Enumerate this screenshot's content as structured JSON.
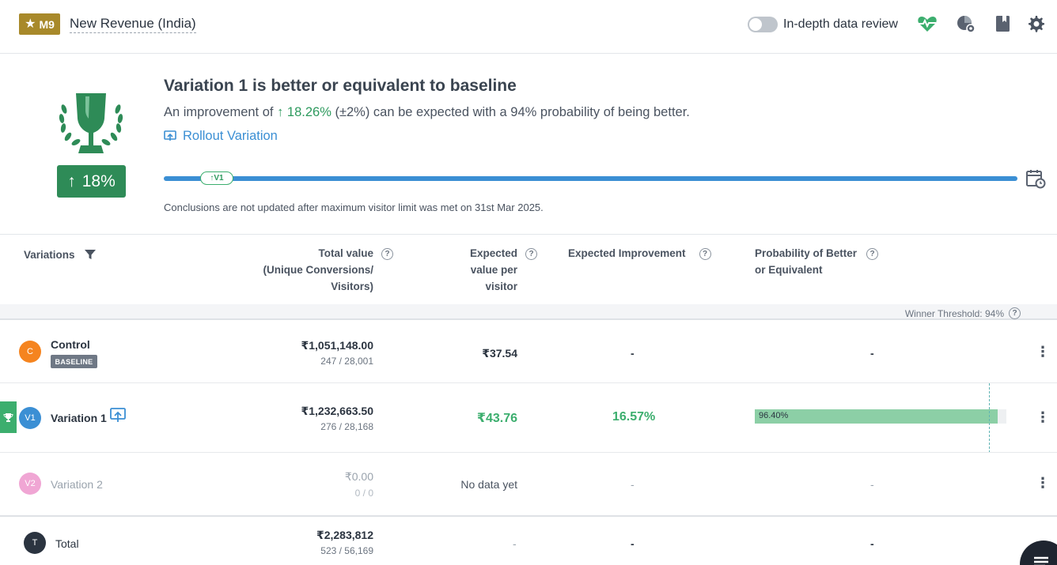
{
  "header": {
    "badge": "M9",
    "title": "New Revenue (India)",
    "toggle_label": "In-depth data review",
    "icons": [
      "star-icon",
      "heart-pulse-icon",
      "pie-chart-settings-icon",
      "book-icon",
      "gear-icon"
    ]
  },
  "summary": {
    "headline": "Variation 1 is better or equivalent to baseline",
    "sub_prefix": "An improvement of ",
    "sub_arrow": "↑",
    "sub_value": "18.26%",
    "sub_suffix": " (±2%) can be expected with a 94% probability of being better.",
    "rollout_label": "Rollout Variation",
    "lift_badge": "18%",
    "lift_arrow": "↑",
    "progress_pill": "↑V1",
    "conclusion": "Conclusions are not updated after maximum visitor limit was met on 31st Mar 2025."
  },
  "table": {
    "headers": {
      "variations": "Variations",
      "total_value_1": "Total value",
      "total_value_2": "(Unique Conversions/",
      "total_value_3": "Visitors)",
      "expected_1": "Expected",
      "expected_2": "value per",
      "expected_3": "visitor",
      "improvement": "Expected Improvement",
      "probability_1": "Probability of Better",
      "probability_2": "or Equivalent",
      "help": "?"
    },
    "winner_threshold": "Winner Threshold: 94%",
    "rows": [
      {
        "avatar": "C",
        "name": "Control",
        "tag": "BASELINE",
        "total": "₹1,051,148.00",
        "sub": "247 / 28,001",
        "expected": "₹37.54",
        "improvement": "-",
        "probability": "-"
      },
      {
        "avatar": "V1",
        "name": "Variation 1",
        "total": "₹1,232,663.50",
        "sub": "276 / 28,168",
        "expected": "₹43.76",
        "improvement": "16.57%",
        "probability": "96.40%",
        "probability_value": 96.4
      },
      {
        "avatar": "V2",
        "name": "Variation 2",
        "total": "₹0.00",
        "sub": "0 / 0",
        "expected": "No data yet",
        "improvement": "-",
        "probability": "-"
      }
    ],
    "total": {
      "avatar": "T",
      "name": "Total",
      "total": "₹2,283,812",
      "sub": "523 / 56,169",
      "expected": "-",
      "improvement": "-",
      "probability": "-"
    }
  },
  "colors": {
    "badge": "#a8892a",
    "green": "#2e8b57",
    "blue": "#3b8fd4",
    "control": "#f5841f",
    "variation1": "#3b8fd4",
    "variation2": "#f0a6d4",
    "total": "#2b3440"
  }
}
